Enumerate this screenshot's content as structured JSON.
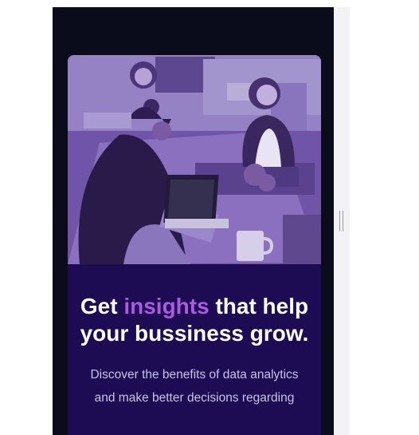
{
  "card": {
    "image_alt": "People working at a shared desk with laptops",
    "headline": {
      "before": "Get ",
      "accent": "insights",
      "after": " that help your bussiness grow."
    },
    "description": "Discover the benefits of data analytics and make better decisions regarding"
  },
  "colors": {
    "page_background": "#0a0c1b",
    "card_background": "#1d0b53",
    "accent": "#aa5bdf",
    "image_tint": "#7b5bb8",
    "body_text": "#c9c3e4"
  }
}
